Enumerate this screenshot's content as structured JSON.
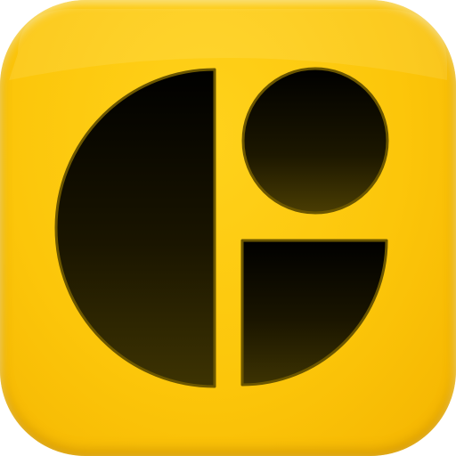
{
  "icon": {
    "semantic": "glyph-logo-icon",
    "colors": {
      "background": "#fcc60a",
      "background_highlight": "#ffd21c",
      "background_shadow": "#f4b400",
      "shape_fill_top": "#000000",
      "shape_fill_bottom": "#3d3302",
      "shape_outline": "#6b5600"
    },
    "shapes": [
      "left-half-disc",
      "top-right-circle",
      "bottom-right-quarter-disc"
    ]
  }
}
